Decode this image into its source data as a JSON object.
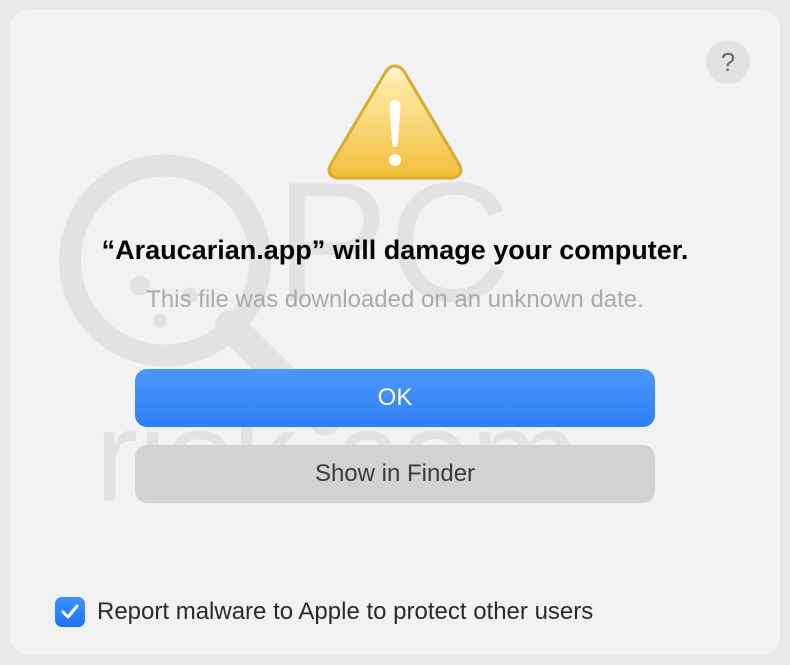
{
  "dialog": {
    "app_name": "Araucarian.app",
    "headline_prefix": "“",
    "headline_suffix": "” will damage your computer.",
    "subtext": "This file was downloaded on an unknown date.",
    "primary_button": "OK",
    "secondary_button": "Show in Finder",
    "checkbox_label": "Report malware to Apple to protect other users",
    "checkbox_checked": true,
    "help_label": "?"
  },
  "icons": {
    "warning": "warning-triangle",
    "help": "question-mark"
  },
  "colors": {
    "primary": "#2f7ff5",
    "warning_fill": "#f7c94a",
    "warning_border": "#d9ad2e"
  }
}
